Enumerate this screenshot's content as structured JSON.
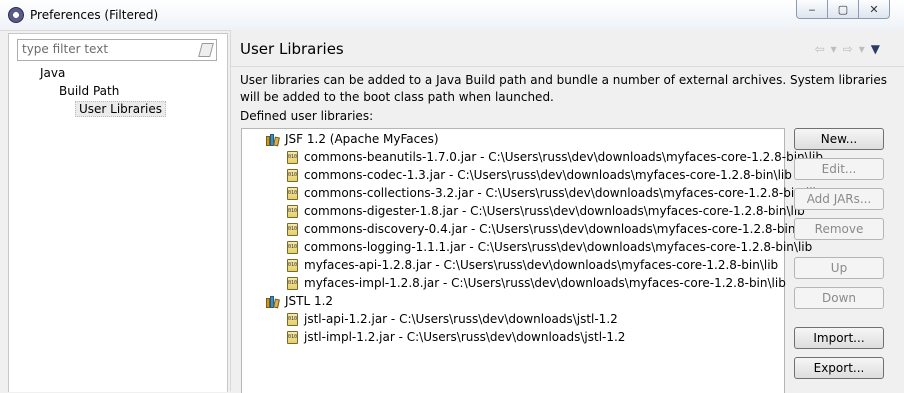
{
  "window": {
    "title": "Preferences (Filtered)",
    "controls": [
      "‒",
      "▢",
      "✕"
    ]
  },
  "sidebar": {
    "filter_placeholder": "type filter text",
    "tree": [
      {
        "label": "Java"
      },
      {
        "label": "Build Path"
      },
      {
        "label": "User Libraries",
        "selected": true
      }
    ]
  },
  "page": {
    "title": "User Libraries",
    "nav": {
      "back": "⇦",
      "forward": "⇨",
      "dropdown": "▾",
      "menu": "▼"
    },
    "description": "User libraries can be added to a Java Build path and bundle a number of external archives. System libraries will be added to the boot class path when launched.",
    "defined_label": "Defined user libraries:"
  },
  "libraries": [
    {
      "name": "JSF 1.2 (Apache MyFaces)",
      "jars": [
        "commons-beanutils-1.7.0.jar - C:\\Users\\russ\\dev\\downloads\\myfaces-core-1.2.8-bin\\lib",
        "commons-codec-1.3.jar - C:\\Users\\russ\\dev\\downloads\\myfaces-core-1.2.8-bin\\lib",
        "commons-collections-3.2.jar - C:\\Users\\russ\\dev\\downloads\\myfaces-core-1.2.8-bin\\lib",
        "commons-digester-1.8.jar - C:\\Users\\russ\\dev\\downloads\\myfaces-core-1.2.8-bin\\lib",
        "commons-discovery-0.4.jar - C:\\Users\\russ\\dev\\downloads\\myfaces-core-1.2.8-bin\\lib",
        "commons-logging-1.1.1.jar - C:\\Users\\russ\\dev\\downloads\\myfaces-core-1.2.8-bin\\lib",
        "myfaces-api-1.2.8.jar - C:\\Users\\russ\\dev\\downloads\\myfaces-core-1.2.8-bin\\lib",
        "myfaces-impl-1.2.8.jar - C:\\Users\\russ\\dev\\downloads\\myfaces-core-1.2.8-bin\\lib"
      ]
    },
    {
      "name": "JSTL 1.2",
      "jars": [
        "jstl-api-1.2.jar - C:\\Users\\russ\\dev\\downloads\\jstl-1.2",
        "jstl-impl-1.2.jar - C:\\Users\\russ\\dev\\downloads\\jstl-1.2"
      ]
    }
  ],
  "buttons": {
    "new": "New...",
    "edit": "Edit...",
    "add_jars": "Add JARs...",
    "remove": "Remove",
    "up": "Up",
    "down": "Down",
    "import": "Import...",
    "export": "Export..."
  }
}
